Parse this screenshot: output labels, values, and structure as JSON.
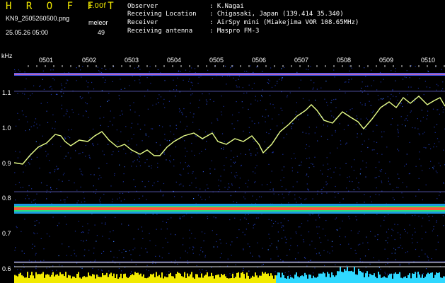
{
  "header": {
    "brand": "H R O F F T",
    "version": "1.00f",
    "filename": "KN9_2505260500.png",
    "mode": "meleor",
    "timestamp": "25.05.26 05:00",
    "count": "49",
    "info": [
      {
        "label": "Observer",
        "value": ": K.Nagai"
      },
      {
        "label": "Receiving Location",
        "value": ": Chigasaki, Japan (139.414 35.340)"
      },
      {
        "label": "Receiver",
        "value": ": AirSpy mini (Miakejima VOR 108.65MHz)"
      },
      {
        "label": "Receiving antenna",
        "value": ": Maspro FM-3"
      }
    ]
  },
  "y_axis": {
    "unit": "kHz",
    "ticks": [
      "1.1",
      "1.0",
      "0.9",
      "0.8",
      "0.7",
      "0.6"
    ]
  },
  "x_axis": {
    "ticks": [
      "0501",
      "0502",
      "0503",
      "0504",
      "0505",
      "0506",
      "0507",
      "0508",
      "0509",
      "0510"
    ]
  },
  "colors": {
    "background": "#000000",
    "noise": "#1a2f9c",
    "trace": "#e8ff8a",
    "band": "#ff5a3c",
    "guide": "#8080ff",
    "bottom_left": "#f2ea00",
    "bottom_right": "#2fd8ff"
  }
}
